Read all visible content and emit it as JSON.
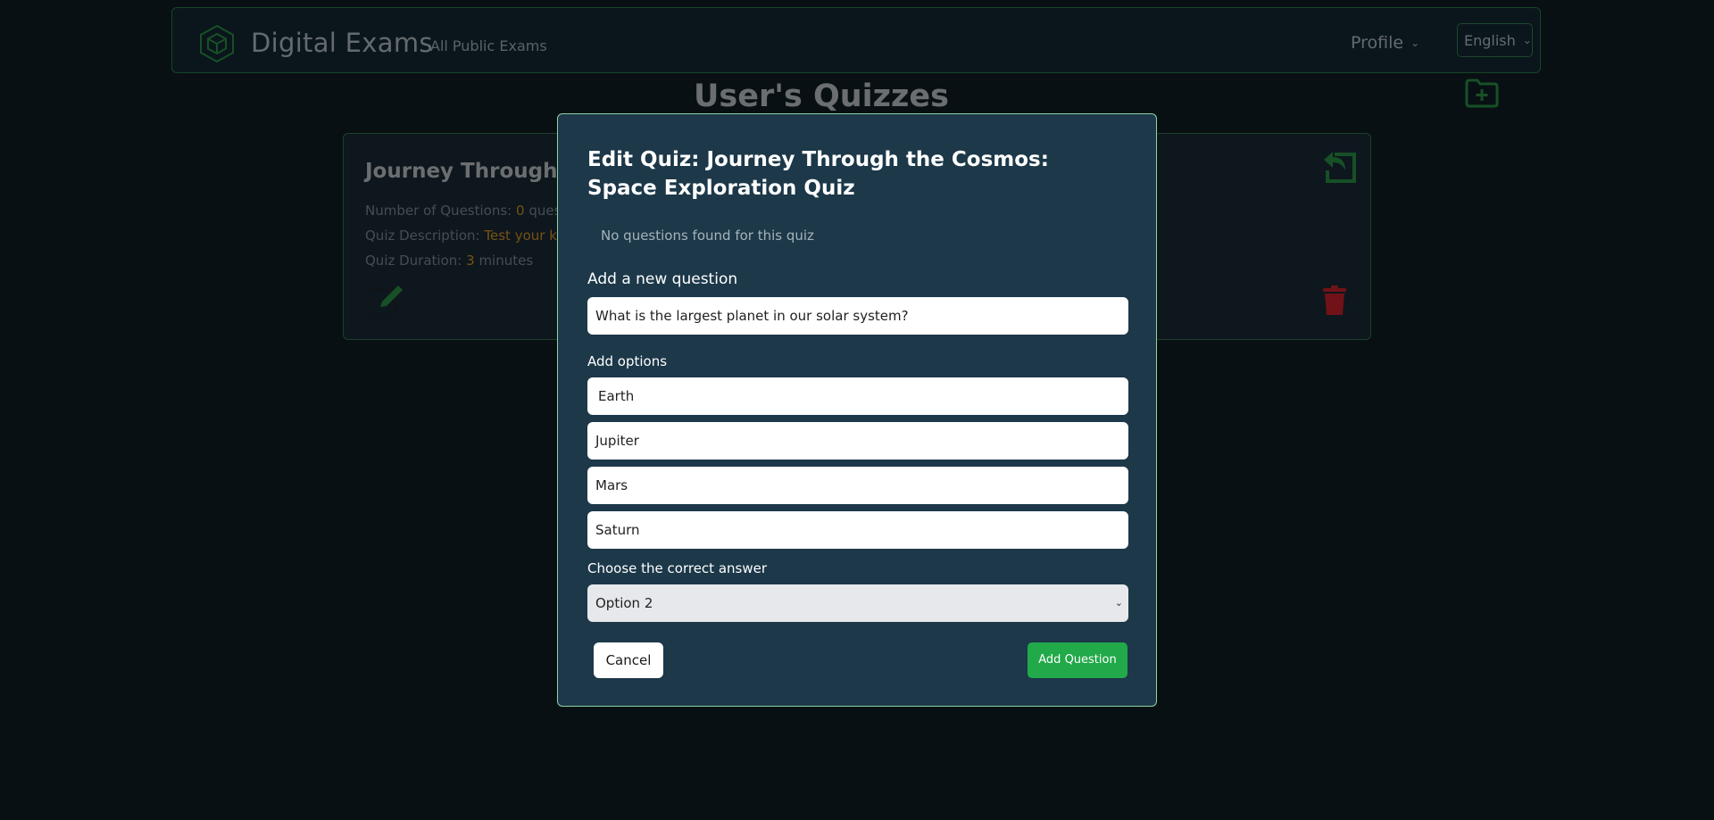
{
  "navbar": {
    "brand": "Digital Exams",
    "nav_link": "All Public Exams",
    "profile_label": "Profile",
    "language": "English"
  },
  "page": {
    "title": "User's Quizzes"
  },
  "quiz_card": {
    "title": "Journey Through th",
    "questions_label": "Number of Questions:",
    "questions_value": "0",
    "questions_suffix": "questio",
    "description_label": "Quiz Description:",
    "description_value": "Test your kno",
    "duration_label": "Quiz Duration:",
    "duration_value": "3",
    "duration_suffix": "minutes"
  },
  "modal": {
    "title": "Edit Quiz: Journey Through the Cosmos: Space Exploration Quiz",
    "no_questions": "No questions found for this quiz",
    "add_question_label": "Add a new question",
    "question_value": "What is the largest planet in our solar system?",
    "options_label": "Add options",
    "options": [
      "Earth",
      "Jupiter",
      "Mars",
      "Saturn"
    ],
    "correct_label": "Choose the correct answer",
    "correct_value": "Option 2",
    "cancel_label": "Cancel",
    "add_label": "Add Question"
  },
  "colors": {
    "accent_green": "#22a94a",
    "modal_bg": "#1c3849",
    "danger_red": "#e0242f",
    "highlight_orange": "#f0a028"
  },
  "icons": {
    "logo": "hexagon-cube-icon",
    "folder": "folder-plus-icon",
    "undo": "share-back-icon",
    "edit": "edit-icon",
    "delete": "trash-icon"
  }
}
